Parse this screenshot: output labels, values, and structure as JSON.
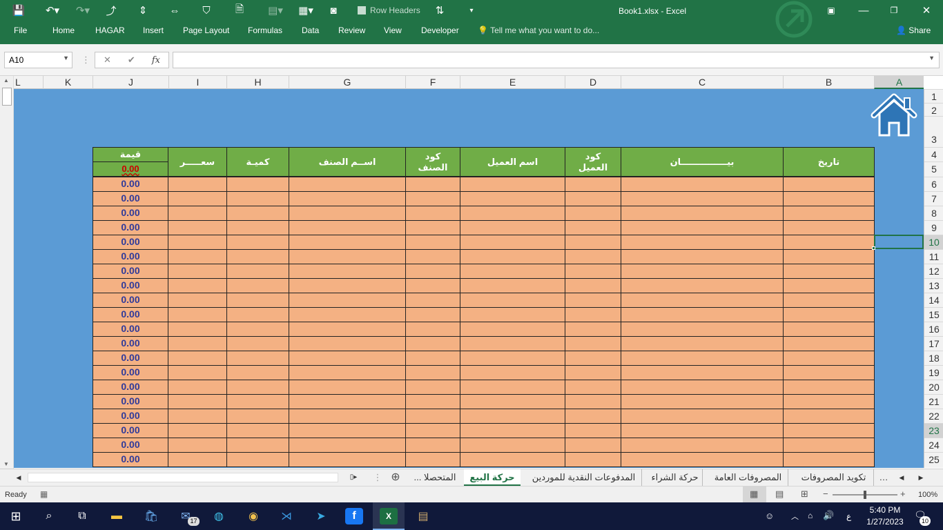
{
  "window": {
    "title": "Book1.xlsx - Excel",
    "share_label": "Share",
    "row_headers_label": "Row Headers"
  },
  "ribbon": {
    "tabs": [
      "File",
      "Home",
      "HAGAR",
      "Insert",
      "Page Layout",
      "Formulas",
      "Data",
      "Review",
      "View",
      "Developer"
    ],
    "tell_me": "Tell me what you want to do..."
  },
  "formula_bar": {
    "name_box": "A10",
    "fx": "fx",
    "cancel": "✕",
    "enter": "✔",
    "value": ""
  },
  "columns": [
    "L",
    "K",
    "J",
    "I",
    "H",
    "G",
    "F",
    "E",
    "D",
    "C",
    "B",
    "A"
  ],
  "rows": [
    "1",
    "2",
    "3",
    "4",
    "5",
    "6",
    "7",
    "8",
    "9",
    "10",
    "11",
    "12",
    "13",
    "14",
    "15",
    "16",
    "17",
    "18",
    "19",
    "20",
    "21",
    "22",
    "23",
    "24",
    "25"
  ],
  "table": {
    "headers": {
      "value": "قيمة",
      "price": "سعـــــر",
      "qty": "كميـة",
      "item_name": "اســم الصنف",
      "item_code": "كود الصنف",
      "customer_name": "اسم العميل",
      "customer_code": "كود العميل",
      "statement": "بيـــــــــــــــان",
      "date": "تاريخ"
    },
    "total": "0.00",
    "values": [
      "0.00",
      "0.00",
      "0.00",
      "0.00",
      "0.00",
      "0.00",
      "0.00",
      "0.00",
      "0.00",
      "0.00",
      "0.00",
      "0.00",
      "0.00",
      "0.00",
      "0.00",
      "0.00",
      "0.00",
      "0.00",
      "0.00",
      "0.00"
    ]
  },
  "sheet_tabs": [
    "تكويد المصروفات",
    "المصروفات العامة",
    "حركة الشراء",
    "المدفوعات النقدية للموردين",
    "حركة البيع",
    "المتحصلا ..."
  ],
  "active_sheet": "حركة البيع",
  "status": {
    "ready": "Ready",
    "zoom": "100%"
  },
  "taskbar": {
    "time": "5:40 PM",
    "date": "1/27/2023",
    "mail_badge": "17",
    "notif_badge": "10",
    "lang": "ع"
  },
  "colors": {
    "ribbon": "#217346",
    "sheet_bg": "#5b9bd5",
    "header_fill": "#70ad47",
    "data_fill": "#f4b183",
    "value_text": "#2f3a9a"
  }
}
